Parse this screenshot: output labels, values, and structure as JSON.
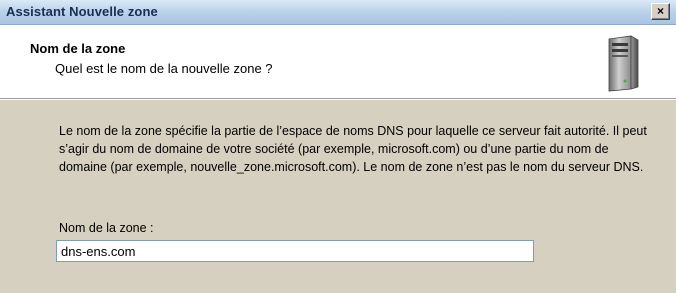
{
  "window": {
    "title": "Assistant Nouvelle zone",
    "close_glyph": "×"
  },
  "header": {
    "title": "Nom de la zone",
    "subtitle": "Quel est le nom de la nouvelle zone ?",
    "icon": "server-icon"
  },
  "body": {
    "description": "Le nom de la zone spécifie la partie de l’espace de noms DNS pour laquelle ce serveur fait autorité. Il peut s’agir du nom de domaine de votre société (par exemple, microsoft.com) ou d’une partie du nom de domaine (par exemple, nouvelle_zone.microsoft.com). Le nom de zone n’est pas le nom du serveur DNS.",
    "zone_label": "Nom de la zone :",
    "zone_value": "dns-ens.com"
  }
}
